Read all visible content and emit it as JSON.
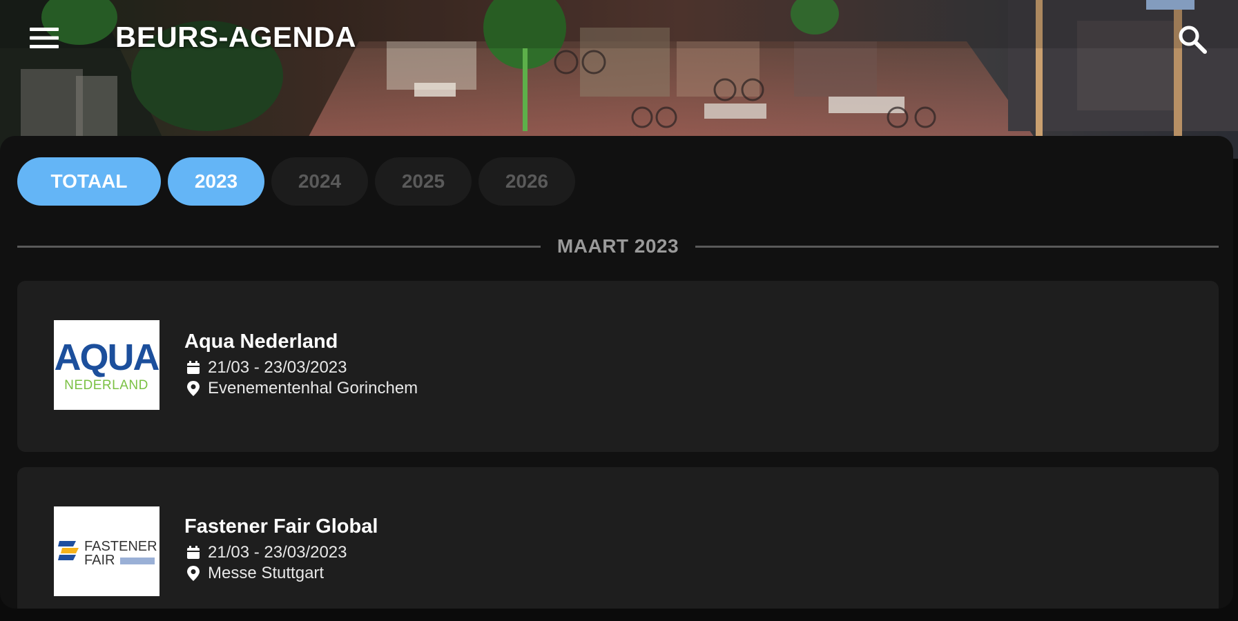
{
  "app": {
    "title": "BEURS-AGENDA"
  },
  "icons": {
    "menu": "menu-icon",
    "search": "search-icon",
    "calendar": "calendar-icon",
    "location": "location-pin-icon"
  },
  "colors": {
    "accent": "#64b5f6",
    "background": "#111111",
    "card": "#1e1e1e",
    "inactive_tab": "#1c1c1c",
    "inactive_tab_text": "#5a5a5a"
  },
  "tabs": [
    {
      "label": "TOTAAL",
      "active": true
    },
    {
      "label": "2023",
      "active": true
    },
    {
      "label": "2024",
      "active": false
    },
    {
      "label": "2025",
      "active": false
    },
    {
      "label": "2026",
      "active": false
    }
  ],
  "section": {
    "month_label": "MAART 2023"
  },
  "events": [
    {
      "name": "Aqua Nederland",
      "dates": "21/03 - 23/03/2023",
      "venue": "Evenementenhal Gorinchem",
      "logo_text_top": "AQUA",
      "logo_text_bottom": "NEDERLAND"
    },
    {
      "name": "Fastener Fair Global",
      "dates": "21/03 - 23/03/2023",
      "venue": "Messe Stuttgart",
      "logo_text_top": "FASTENER",
      "logo_text_bottom": "FAIR"
    }
  ]
}
